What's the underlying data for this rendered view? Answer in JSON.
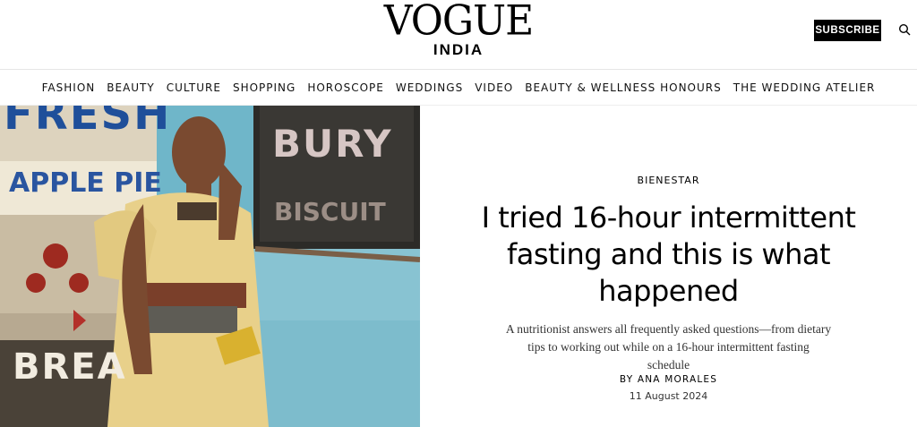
{
  "header": {
    "logo_main": "VOGUE",
    "logo_sub": "INDIA",
    "subscribe_label": "SUBSCRIBE",
    "search_icon": "search-icon"
  },
  "nav": {
    "items": [
      "FASHION",
      "BEAUTY",
      "CULTURE",
      "SHOPPING",
      "HOROSCOPE",
      "WEDDINGS",
      "VIDEO",
      "BEAUTY & WELLNESS HONOURS",
      "THE WEDDING ATELIER"
    ]
  },
  "hero": {
    "sign_fresh": "FRESH",
    "sign_applepie": "APPLE PIE",
    "sign_bury": "BURY",
    "sign_biscuit": "BISCUIT",
    "sign_bread": "BREA"
  },
  "article": {
    "category": "BIENESTAR",
    "headline": "I tried 16-hour intermittent fasting and this is what happened",
    "dek": "A nutritionist answers all frequently asked questions—from dietary tips to working out while on a 16-hour intermittent fasting schedule",
    "byline": "BY ANA MORALES",
    "date": "11 August 2024"
  }
}
